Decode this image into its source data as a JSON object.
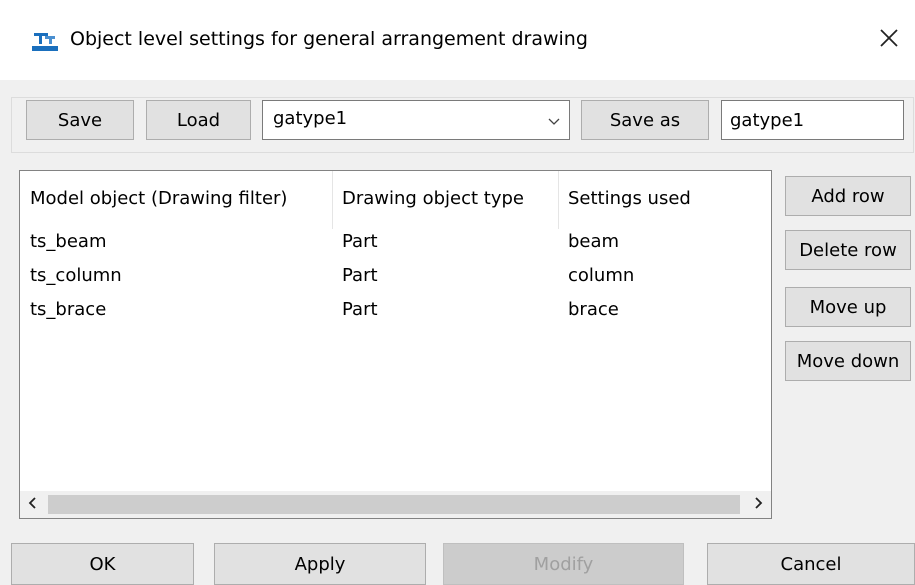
{
  "window": {
    "title": "Object level settings for general arrangement drawing",
    "app_icon": "tekla-drawing-icon",
    "close_icon": "close-icon"
  },
  "toolbar": {
    "save_label": "Save",
    "load_label": "Load",
    "settings_combo": {
      "value": "gatype1",
      "dropdown_icon": "chevron-down-icon"
    },
    "save_as_label": "Save as",
    "save_as_input": {
      "value": "gatype1"
    }
  },
  "table": {
    "columns": [
      "Model object (Drawing filter)",
      "Drawing object type",
      "Settings used"
    ],
    "rows": [
      [
        "ts_beam",
        "Part",
        "beam"
      ],
      [
        "ts_column",
        "Part",
        "column"
      ],
      [
        "ts_brace",
        "Part",
        "brace"
      ]
    ],
    "scrollbar": {
      "left_icon": "chevron-left-icon",
      "right_icon": "chevron-right-icon"
    }
  },
  "side_buttons": {
    "add_row": "Add row",
    "delete_row": "Delete row",
    "move_up": "Move up",
    "move_down": "Move down"
  },
  "footer": {
    "ok": "OK",
    "apply": "Apply",
    "modify": "Modify",
    "cancel": "Cancel"
  },
  "colors": {
    "title_bar": "#ffffff",
    "dialog_background": "#f0f0f0",
    "button_face": "#e1e1e1",
    "button_border": "#adadad",
    "disabled_text": "#a0a0a0",
    "icon_blue": "#1a6fbd"
  }
}
